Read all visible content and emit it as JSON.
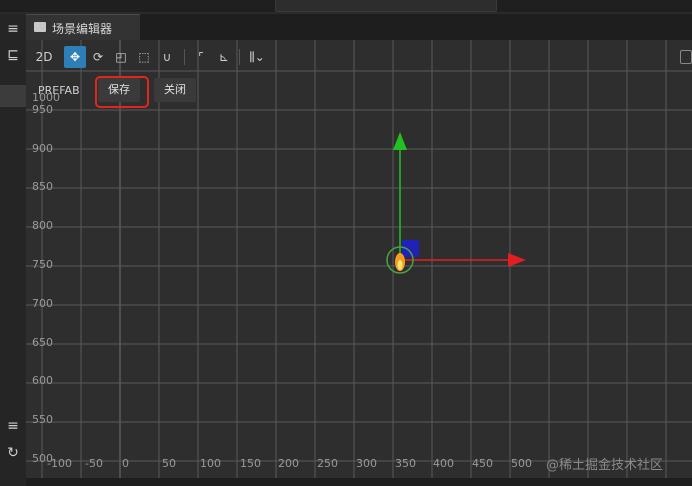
{
  "tab": {
    "title": "场景编辑器",
    "icon": "scene-icon"
  },
  "toolbar": {
    "mode_2d": "2D",
    "tools": [
      "move-tool-icon",
      "rotate-tool-icon",
      "scale-tool-icon",
      "rect-tool-icon",
      "magnet-icon",
      "pivot-icon",
      "local-icon",
      "align-icon"
    ]
  },
  "prefab": {
    "label": "PREFAB",
    "save": "保存",
    "close": "关闭"
  },
  "axes": {
    "y_ticks": [
      "1000",
      "950",
      "900",
      "850",
      "800",
      "750",
      "700",
      "650",
      "600",
      "550",
      "500"
    ],
    "x_ticks": [
      "-100",
      "-50",
      "0",
      "50",
      "100",
      "150",
      "200",
      "250",
      "300",
      "350",
      "400",
      "450",
      "500"
    ]
  },
  "watermark": "@稀土掘金技术社区",
  "colors": {
    "accent": "#2e7fb8",
    "grid": "#5a5a5a",
    "x_axis": "#e02020",
    "y_axis": "#22c022",
    "highlight": "#e0261e"
  }
}
